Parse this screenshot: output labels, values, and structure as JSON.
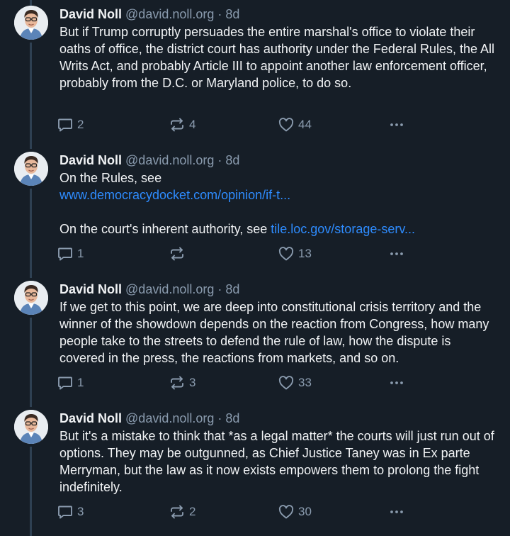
{
  "colors": {
    "background": "#161e27",
    "text": "#f1f3f5",
    "muted": "#8a9bae",
    "link": "#2e8cff",
    "thread_line": "#2e4052"
  },
  "icons": {
    "reply": "reply-icon",
    "repost": "repost-icon",
    "like": "heart-icon",
    "more": "more-options-icon"
  },
  "posts": [
    {
      "author_name": "David Noll",
      "handle": "@david.noll.org",
      "separator": " · ",
      "time": "8d",
      "text": "But if Trump corruptly persuades the entire marshal's office to violate their oaths of office, the district court has authority under the Federal Rules, the All Writs Act, and probably Article III to appoint another law enforcement officer, probably from the D.C. or Maryland police, to do so.",
      "reply_count": "2",
      "repost_count": "4",
      "like_count": "44"
    },
    {
      "author_name": "David Noll",
      "handle": "@david.noll.org",
      "separator": " · ",
      "time": "8d",
      "text_line1": "On the Rules, see",
      "link1": "www.democracydocket.com/opinion/if-t...",
      "text_line3": "On the court's inherent authority, see ",
      "link2": "tile.loc.gov/storage-serv...",
      "reply_count": "1",
      "repost_count": "",
      "like_count": "13"
    },
    {
      "author_name": "David Noll",
      "handle": "@david.noll.org",
      "separator": " · ",
      "time": "8d",
      "text": "If we get to this point, we are deep into constitutional crisis territory and the winner of the showdown depends on the reaction from Congress, how many people take to the streets to defend the rule of law, how the dispute is covered in the press, the reactions from markets, and so on.",
      "reply_count": "1",
      "repost_count": "3",
      "like_count": "33"
    },
    {
      "author_name": "David Noll",
      "handle": "@david.noll.org",
      "separator": " · ",
      "time": "8d",
      "text": "But it's a mistake to think that *as a legal matter* the courts will just run out of options. They may be outgunned, as Chief Justice Taney was in Ex parte Merryman, but the law as it now exists empowers them to prolong the fight indefinitely.",
      "reply_count": "3",
      "repost_count": "2",
      "like_count": "30"
    }
  ]
}
